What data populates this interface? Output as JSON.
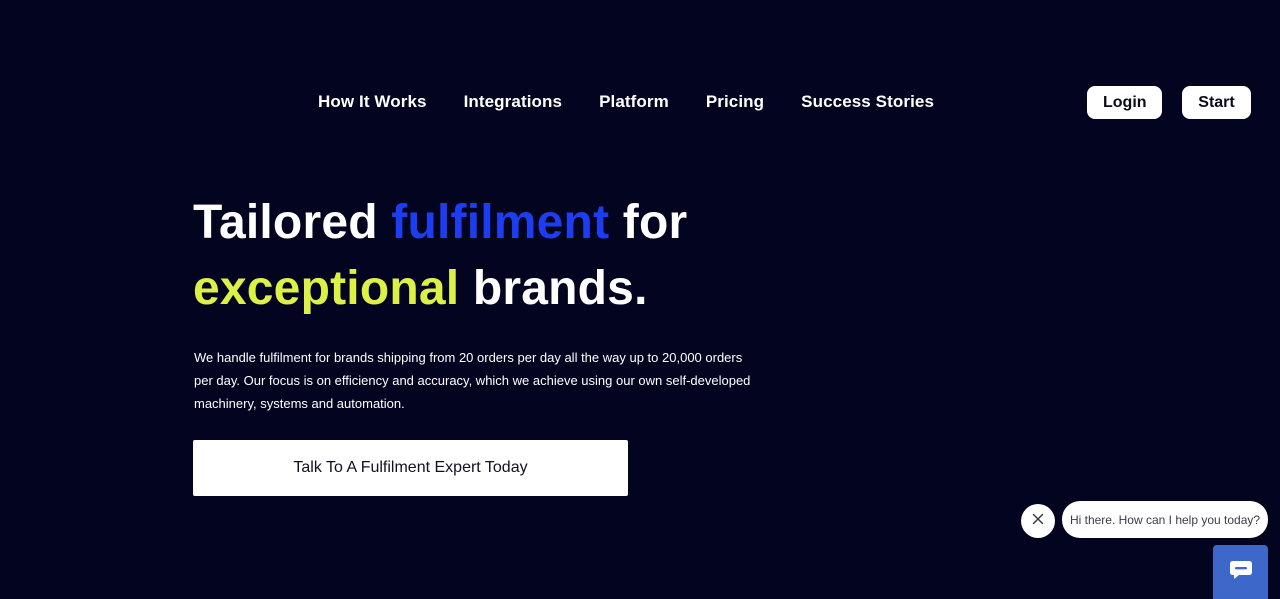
{
  "nav": {
    "items": [
      {
        "label": "How It Works"
      },
      {
        "label": "Integrations"
      },
      {
        "label": "Platform"
      },
      {
        "label": "Pricing"
      },
      {
        "label": "Success Stories"
      }
    ],
    "login_label": "Login",
    "start_label": "Start"
  },
  "hero": {
    "title_part1": "Tailored ",
    "title_highlight1": "fulfilment",
    "title_part2": " for",
    "title_highlight2": "exceptional",
    "title_part3": " brands.",
    "description": "We handle fulfilment for brands shipping from 20 orders per day all the way up to 20,000 orders per day. Our focus is on efficiency and accuracy, which we achieve using our own self-developed machinery, systems and automation.",
    "cta_label": "Talk To A Fulfilment Expert Today"
  },
  "chat": {
    "greeting": "Hi there. How can I help you today?",
    "close_icon": "close-icon",
    "launcher_icon": "chat-icon"
  },
  "colors": {
    "background": "#03041f",
    "accent_blue": "#1c3ef0",
    "accent_lime": "#dcf045",
    "chat_launcher": "#3d68c9"
  }
}
